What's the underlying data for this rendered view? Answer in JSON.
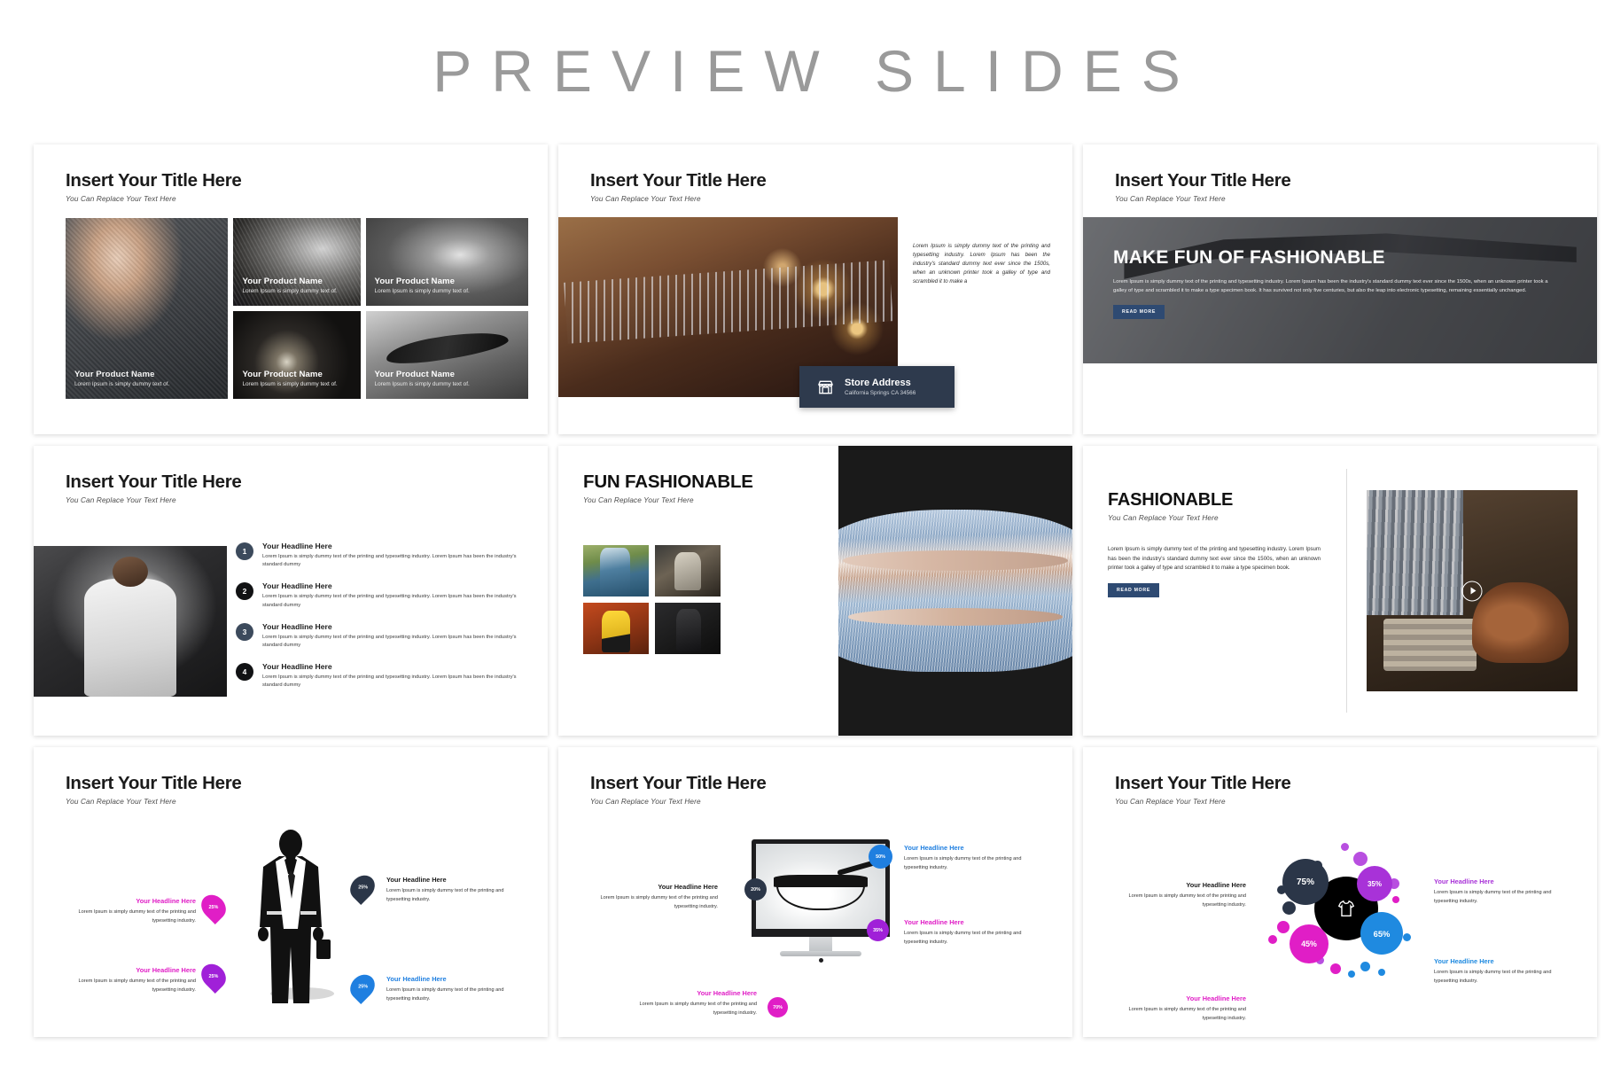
{
  "header": {
    "title": "PREVIEW SLIDES"
  },
  "common": {
    "title": "Insert Your Title Here",
    "subtitle": "You Can Replace Your Text Here",
    "headline": "Your Headline Here",
    "read_more": "READ MORE",
    "lorem_short": "Lorem Ipsum is simply dummy text of the printing and typesetting industry.",
    "lorem_med": "Lorem Ipsum is simply dummy text of the printing and typesetting industry. Lorem Ipsum has been the industry's standard dummy"
  },
  "slide1": {
    "title": "Insert Your Title Here",
    "subtitle": "You Can Replace Your Text Here",
    "products": [
      {
        "name": "Your Product Name",
        "desc": "Lorem Ipsum is simply dummy text of.",
        "image": "dress-shirt-photo"
      },
      {
        "name": "Your Product Name",
        "desc": "Lorem Ipsum is simply dummy text of.",
        "image": "hand-in-pocket-photo"
      },
      {
        "name": "Your Product Name",
        "desc": "Lorem Ipsum is simply dummy text of.",
        "image": "sneakers-photo"
      },
      {
        "name": "Your Product Name",
        "desc": "Lorem Ipsum is simply dummy text of.",
        "image": "wrist-watch-photo"
      },
      {
        "name": "Your Product Name",
        "desc": "Lorem Ipsum is simply dummy text of.",
        "image": "eyeglasses-photo"
      }
    ]
  },
  "slide2": {
    "title": "Insert Your Title Here",
    "subtitle": "You Can Replace Your Text Here",
    "body": "Lorem Ipsum is simply dummy text of the printing and typesetting industry. Lorem Ipsum has been the industry's standard dummy text ever since the 1500s, when an unknown printer took a galley of type and scrambled it to make a",
    "address_card": {
      "title": "Store Address",
      "address": "California Springs CA 34566",
      "icon": "store-icon",
      "bg": "#2e3a4d"
    },
    "image": "clothes-rack-photo"
  },
  "slide3": {
    "title": "Insert Your Title Here",
    "subtitle": "You Can Replace Your Text Here",
    "hero_heading": "MAKE FUN OF FASHIONABLE",
    "hero_body": "Lorem Ipsum is simply dummy text of the printing and typesetting industry. Lorem Ipsum has been the industry's standard dummy text ever since the 1500s, when an unknown printer took a galley of type and scrambled it to make a type specimen book. It has survived not only five centuries, but also the leap into electronic typesetting, remaining essentially unchanged.",
    "button": "READ MORE",
    "image": "eyeglasses-hero-photo"
  },
  "slide4": {
    "title": "Insert Your Title Here",
    "subtitle": "You Can Replace Your Text Here",
    "image": "man-white-tshirt-photo",
    "items": [
      {
        "num": "1",
        "headline": "Your Headline Here",
        "text": "Lorem Ipsum is simply dummy text of the printing and typesetting industry. Lorem Ipsum has been the industry's standard dummy",
        "color": "#3c4a5c"
      },
      {
        "num": "2",
        "headline": "Your Headline Here",
        "text": "Lorem Ipsum is simply dummy text of the printing and typesetting industry. Lorem Ipsum has been the industry's standard dummy",
        "color": "#111214"
      },
      {
        "num": "3",
        "headline": "Your Headline Here",
        "text": "Lorem Ipsum is simply dummy text of the printing and typesetting industry. Lorem Ipsum has been the industry's standard dummy",
        "color": "#3c4a5c"
      },
      {
        "num": "4",
        "headline": "Your Headline Here",
        "text": "Lorem Ipsum is simply dummy text of the printing and typesetting industry. Lorem Ipsum has been the industry's standard dummy",
        "color": "#111214"
      }
    ]
  },
  "slide5": {
    "heading": "FUN FASHIONABLE",
    "subtitle": "You Can Replace Your Text Here",
    "thumbs": [
      "woman-in-field-photo",
      "couple-street-photo",
      "man-yellow-shirt-photo",
      "man-black-jacket-photo"
    ],
    "big_image": "ripped-denim-photo"
  },
  "slide6": {
    "heading": "FASHIONABLE",
    "subtitle": "You Can Replace Your Text Here",
    "body": "Lorem Ipsum is simply dummy text of the printing and typesetting industry. Lorem Ipsum has been the industry's standard dummy text ever since the 1500s, when an unknown printer took a galley of type and scrambled it to make a type specimen book.",
    "button": "READ MORE",
    "image": "shoes-and-clothes-photo",
    "play_icon": "play-icon"
  },
  "slide7": {
    "title": "Insert Your Title Here",
    "subtitle": "You Can Replace Your Text Here",
    "figure": "businessman-silhouette",
    "callouts": [
      {
        "headline": "Your Headline Here",
        "text": "Lorem Ipsum is simply dummy text of the printing and typesetting industry.",
        "value": "25%",
        "color": "#e01ec6",
        "side": "left"
      },
      {
        "headline": "Your Headline Here",
        "text": "Lorem Ipsum is simply dummy text of the printing and typesetting industry.",
        "value": "25%",
        "color": "#a020d8",
        "side": "left"
      },
      {
        "headline": "Your Headline Here",
        "text": "Lorem Ipsum is simply dummy text of the printing and typesetting industry.",
        "value": "25%",
        "color": "#2b3648",
        "side": "right"
      },
      {
        "headline": "Your Headline Here",
        "text": "Lorem Ipsum is simply dummy text of the printing and typesetting industry.",
        "value": "25%",
        "color": "#1f7fe0",
        "side": "right"
      }
    ]
  },
  "slide8": {
    "title": "Insert Your Title Here",
    "subtitle": "You Can Replace Your Text Here",
    "device": "desktop-monitor",
    "screen_image": "eyeglasses-product-photo",
    "callouts": [
      {
        "headline": "Your Headline Here",
        "text": "Lorem Ipsum is simply dummy text of the printing and typesetting industry.",
        "value": "20%",
        "color": "#2b3648",
        "side": "left"
      },
      {
        "headline": "Your Headline Here",
        "text": "Lorem Ipsum is simply dummy text of the printing and typesetting industry.",
        "value": "50%",
        "color": "#1f7fe0",
        "side": "right"
      },
      {
        "headline": "Your Headline Here",
        "text": "Lorem Ipsum is simply dummy text of the printing and typesetting industry.",
        "value": "35%",
        "color": "#a020d8",
        "side": "right"
      },
      {
        "headline": "Your Headline Here",
        "text": "Lorem Ipsum is simply dummy text of the printing and typesetting industry.",
        "value": "70%",
        "color": "#e01ec6",
        "side": "left"
      }
    ]
  },
  "slide9": {
    "title": "Insert Your Title Here",
    "subtitle": "You Can Replace Your Text Here",
    "center_icon": "tshirt-icon",
    "bubbles": [
      {
        "value": "75%",
        "color": "#2b3648"
      },
      {
        "value": "35%",
        "color": "#a832d8"
      },
      {
        "value": "65%",
        "color": "#1f8ae0"
      },
      {
        "value": "45%",
        "color": "#e01ec6"
      }
    ],
    "callouts": [
      {
        "headline": "Your Headline Here",
        "text": "Lorem Ipsum is simply dummy text of the printing and typesetting industry.",
        "color": "#1b1b1b",
        "side": "left-top"
      },
      {
        "headline": "Your Headline Here",
        "text": "Lorem Ipsum is simply dummy text of the printing and typesetting industry.",
        "color": "#a832d8",
        "side": "right-top"
      },
      {
        "headline": "Your Headline Here",
        "text": "Lorem Ipsum is simply dummy text of the printing and typesetting industry.",
        "color": "#1f8ae0",
        "side": "right-bottom"
      },
      {
        "headline": "Your Headline Here",
        "text": "Lorem Ipsum is simply dummy text of the printing and typesetting industry.",
        "color": "#e01ec6",
        "side": "left-bottom"
      }
    ]
  }
}
